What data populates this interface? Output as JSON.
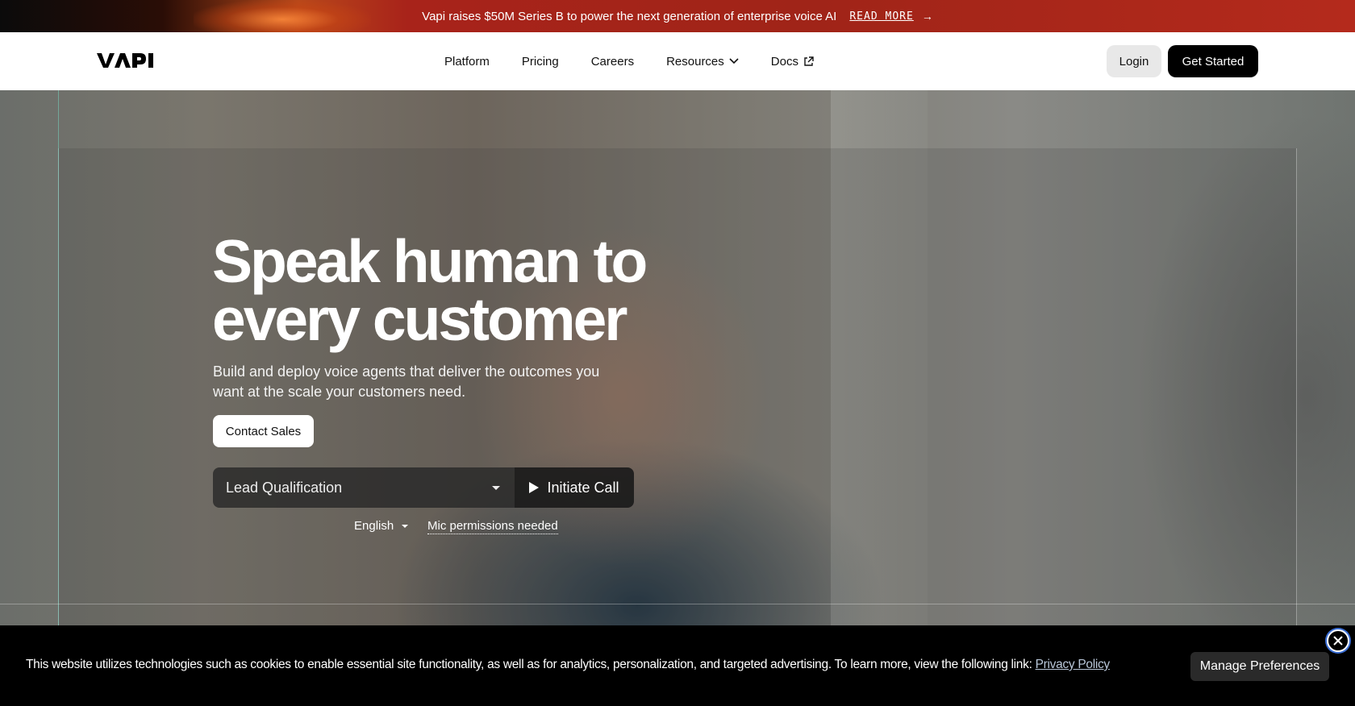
{
  "announcement": {
    "text": "Vapi raises $50M Series B to power the next generation of enterprise voice AI",
    "link": "READ MORE",
    "arrow": "→"
  },
  "nav": {
    "logo_alt": "VAPI",
    "links": [
      {
        "label": "Platform"
      },
      {
        "label": "Pricing"
      },
      {
        "label": "Careers"
      },
      {
        "label": "Resources",
        "icon": "chevron-down-icon"
      },
      {
        "label": "Docs",
        "icon": "external-link-icon"
      }
    ],
    "login": "Login",
    "get_started": "Get Started"
  },
  "hero": {
    "title_line1": "Speak human to",
    "title_line2": "every customer",
    "subtitle": "Build and deploy voice agents that deliver the outcomes you want at the scale your customers need.",
    "contact_sales": "Contact Sales",
    "demo_select": "Lead Qualification",
    "initiate_call": "Initiate Call",
    "language": "English",
    "mic": "Mic permissions needed"
  },
  "cookie": {
    "text": "This website utilizes technologies such as cookies to enable essential site functionality, as well as for analytics, personalization, and targeted advertising. To learn more, view the following link:",
    "link": "Privacy Policy",
    "manage": "Manage Preferences"
  },
  "colors": {
    "announce_red": "#a8231a",
    "primary_black": "#000000",
    "cookie_link": "#b9c7d9"
  }
}
